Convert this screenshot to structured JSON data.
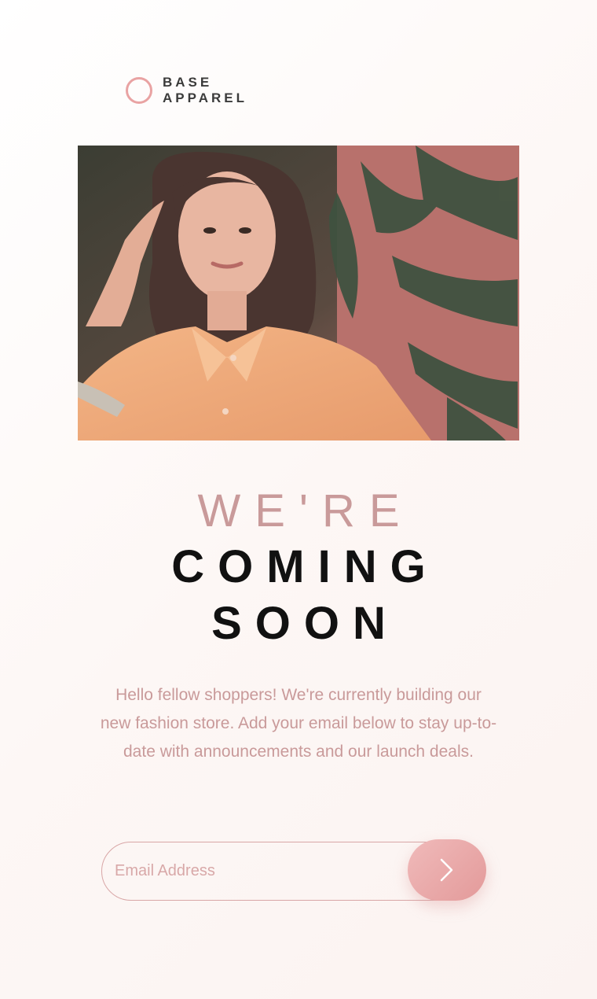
{
  "brand": {
    "line1": "BASE",
    "line2": "APPAREL",
    "accent": "#e9a3a3"
  },
  "hero": {
    "alt": "Woman in peach shirt in front of plants"
  },
  "headline": {
    "line1": "WE'RE",
    "line2": "COMING",
    "line3": "SOON"
  },
  "description": "Hello fellow shoppers! We're currently building our new fashion store. Add your email below to stay up-to-date with announcements and our launch deals.",
  "form": {
    "placeholder": "Email Address",
    "submit_icon": "chevron-right-icon",
    "accent": "#e39a9a"
  }
}
